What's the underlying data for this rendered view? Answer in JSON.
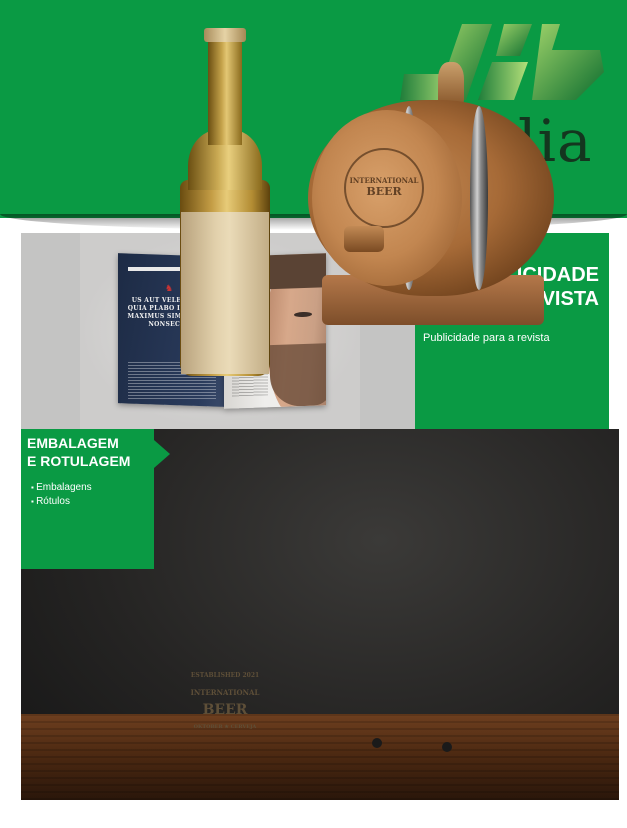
{
  "header": {
    "logo_word": "media",
    "colors": {
      "green": "#0a9a44",
      "dark_green": "#14361f"
    }
  },
  "magazine": {
    "headline": "US AUT VELESSUS ES QUIA PLABO ITATE ESO MAXIMUS SIM EXERUM NONSECTUR"
  },
  "publicidade": {
    "title_line1": "PUBLICIDADE",
    "title_line2": "DE REVISTA",
    "description": "Publicidade para a revista"
  },
  "embalagem": {
    "title_line1": "EMBALAGEM",
    "title_line2": "E ROTULAGEM",
    "items": [
      "Embalagens",
      "Rótulos"
    ]
  },
  "beer_label": {
    "established": "ESTABLISHED 2021",
    "international": "INTERNATIONAL",
    "beer": "BEER",
    "bottom": "OKTOBER ★ CERVEJA"
  },
  "barrel_stamp": {
    "line1": "INTERNATIONAL",
    "line2": "BEER"
  }
}
